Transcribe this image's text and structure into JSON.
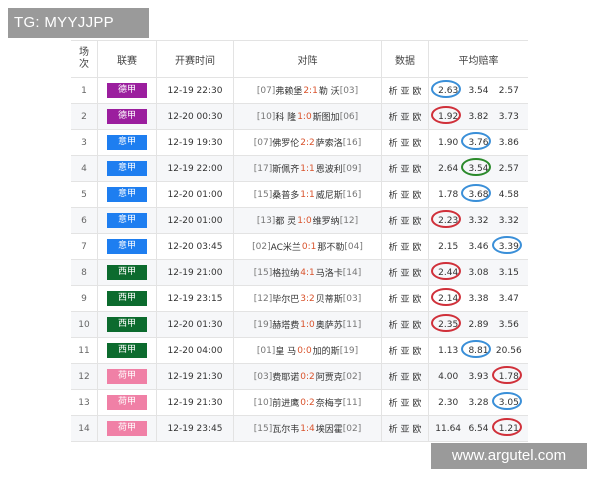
{
  "watermark_top": "TG: MYYJJPP",
  "watermark_bottom": "www.argutel.com",
  "headers": {
    "no": [
      "场",
      "次"
    ],
    "league": "联赛",
    "time": "开赛时间",
    "match": "对阵",
    "data": "数据",
    "odds": "平均赔率"
  },
  "league_colors": {
    "德甲": "#9b1e9e",
    "意甲": "#1e7ef0",
    "西甲": "#0c6b2e",
    "荷甲": "#f080a6"
  },
  "ring_colors": {
    "blue": "#3a8fd8",
    "red": "#d0303a",
    "green": "#2b8a2b"
  },
  "rows": [
    {
      "no": "1",
      "league": "德甲",
      "time": "12-19 22:30",
      "home_rank": "[07]",
      "home": "弗赖堡",
      "score": "2:1",
      "away": "勒 沃",
      "away_rank": "[03]",
      "data": "析 亚 欧",
      "odds": [
        "2.63",
        "3.54",
        "2.57"
      ],
      "circle": [
        0,
        "blue"
      ]
    },
    {
      "no": "2",
      "league": "德甲",
      "time": "12-20 00:30",
      "home_rank": "[10]",
      "home": "科 隆",
      "score": "1:0",
      "away": "斯图加",
      "away_rank": "[06]",
      "data": "析 亚 欧",
      "odds": [
        "1.92",
        "3.82",
        "3.73"
      ],
      "circle": [
        0,
        "red"
      ]
    },
    {
      "no": "3",
      "league": "意甲",
      "time": "12-19 19:30",
      "home_rank": "[07]",
      "home": "佛罗伦",
      "score": "2:2",
      "away": "萨索洛",
      "away_rank": "[16]",
      "data": "析 亚 欧",
      "odds": [
        "1.90",
        "3.76",
        "3.86"
      ],
      "circle": [
        1,
        "blue"
      ]
    },
    {
      "no": "4",
      "league": "意甲",
      "time": "12-19 22:00",
      "home_rank": "[17]",
      "home": "斯佩齐",
      "score": "1:1",
      "away": "恩波利",
      "away_rank": "[09]",
      "data": "析 亚 欧",
      "odds": [
        "2.64",
        "3.54",
        "2.57"
      ],
      "circle": [
        1,
        "green"
      ]
    },
    {
      "no": "5",
      "league": "意甲",
      "time": "12-20 01:00",
      "home_rank": "[15]",
      "home": "桑普多",
      "score": "1:1",
      "away": "威尼斯",
      "away_rank": "[16]",
      "data": "析 亚 欧",
      "odds": [
        "1.78",
        "3.68",
        "4.58"
      ],
      "circle": [
        1,
        "blue"
      ]
    },
    {
      "no": "6",
      "league": "意甲",
      "time": "12-20 01:00",
      "home_rank": "[13]",
      "home": "都 灵",
      "score": "1:0",
      "away": "维罗纳",
      "away_rank": "[12]",
      "data": "析 亚 欧",
      "odds": [
        "2.23",
        "3.32",
        "3.32"
      ],
      "circle": [
        0,
        "red"
      ]
    },
    {
      "no": "7",
      "league": "意甲",
      "time": "12-20 03:45",
      "home_rank": "[02]",
      "home": "AC米兰",
      "score": "0:1",
      "away": "那不勒",
      "away_rank": "[04]",
      "data": "析 亚 欧",
      "odds": [
        "2.15",
        "3.46",
        "3.39"
      ],
      "circle": [
        2,
        "blue"
      ]
    },
    {
      "no": "8",
      "league": "西甲",
      "time": "12-19 21:00",
      "home_rank": "[15]",
      "home": "格拉纳",
      "score": "4:1",
      "away": "马洛卡",
      "away_rank": "[14]",
      "data": "析 亚 欧",
      "odds": [
        "2.44",
        "3.08",
        "3.15"
      ],
      "circle": [
        0,
        "red"
      ]
    },
    {
      "no": "9",
      "league": "西甲",
      "time": "12-19 23:15",
      "home_rank": "[12]",
      "home": "毕尔巴",
      "score": "3:2",
      "away": "贝蒂斯",
      "away_rank": "[03]",
      "data": "析 亚 欧",
      "odds": [
        "2.14",
        "3.38",
        "3.47"
      ],
      "circle": [
        0,
        "red"
      ]
    },
    {
      "no": "10",
      "league": "西甲",
      "time": "12-20 01:30",
      "home_rank": "[19]",
      "home": "赫塔费",
      "score": "1:0",
      "away": "奥萨苏",
      "away_rank": "[11]",
      "data": "析 亚 欧",
      "odds": [
        "2.35",
        "2.89",
        "3.56"
      ],
      "circle": [
        0,
        "red"
      ]
    },
    {
      "no": "11",
      "league": "西甲",
      "time": "12-20 04:00",
      "home_rank": "[01]",
      "home": "皇 马",
      "score": "0:0",
      "away": "加的斯",
      "away_rank": "[19]",
      "data": "析 亚 欧",
      "odds": [
        "1.13",
        "8.81",
        "20.56"
      ],
      "circle": [
        1,
        "blue"
      ]
    },
    {
      "no": "12",
      "league": "荷甲",
      "time": "12-19 21:30",
      "home_rank": "[03]",
      "home": "费耶诺",
      "score": "0:2",
      "away": "阿贾克",
      "away_rank": "[02]",
      "data": "析 亚 欧",
      "odds": [
        "4.00",
        "3.93",
        "1.78"
      ],
      "circle": [
        2,
        "red"
      ]
    },
    {
      "no": "13",
      "league": "荷甲",
      "time": "12-19 21:30",
      "home_rank": "[10]",
      "home": "前进鹰",
      "score": "0:2",
      "away": "奈梅亨",
      "away_rank": "[11]",
      "data": "析 亚 欧",
      "odds": [
        "2.30",
        "3.28",
        "3.05"
      ],
      "circle": [
        2,
        "blue"
      ]
    },
    {
      "no": "14",
      "league": "荷甲",
      "time": "12-19 23:45",
      "home_rank": "[15]",
      "home": "瓦尔韦",
      "score": "1:4",
      "away": "埃因霍",
      "away_rank": "[02]",
      "data": "析 亚 欧",
      "odds": [
        "11.64",
        "6.54",
        "1.21"
      ],
      "circle": [
        2,
        "red"
      ]
    }
  ]
}
